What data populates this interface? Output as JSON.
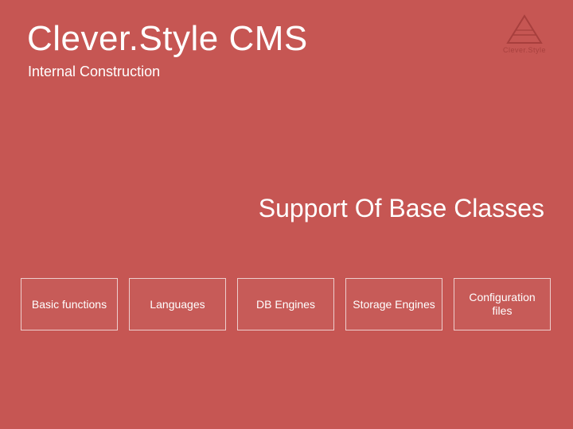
{
  "title": "Clever.Style CMS",
  "subtitle": "Internal Construction",
  "section_heading": "Support Of Base Classes",
  "logo_text": "Clever.Style",
  "boxes": [
    "Basic functions",
    "Languages",
    "DB Engines",
    "Storage Engines",
    "Configuration files"
  ]
}
